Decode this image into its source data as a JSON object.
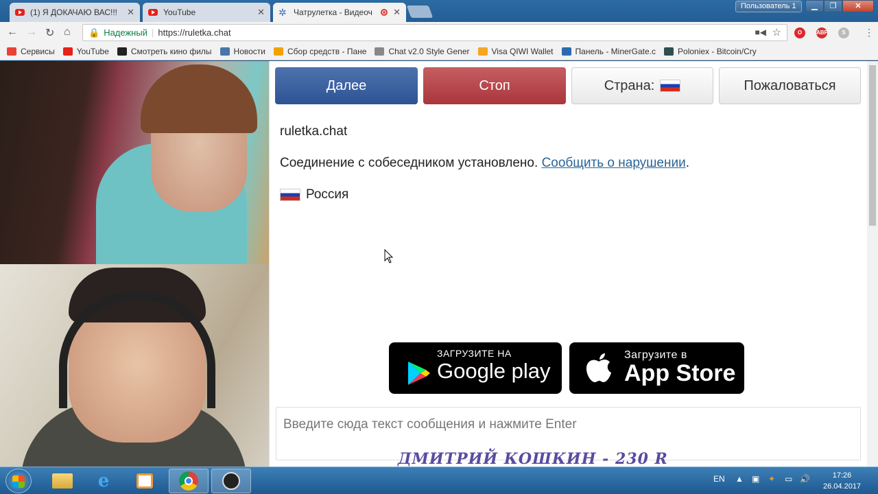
{
  "tabs": [
    {
      "title": "(1) Я ДОКАЧАЮ ВАС!!!",
      "icon": "youtube-icon"
    },
    {
      "title": "YouTube",
      "icon": "youtube-icon"
    },
    {
      "title": "Чатрулетка - Видеоч",
      "icon": "gear-icon"
    }
  ],
  "window": {
    "user_label": "Пользователь 1"
  },
  "toolbar": {
    "secure_label": "Надежный",
    "url": "https://ruletka.chat"
  },
  "bookmarks": [
    {
      "label": "Сервисы",
      "icon": "apps-icon",
      "color": "#e94235"
    },
    {
      "label": "YouTube",
      "icon": "youtube-icon",
      "color": "#e62117"
    },
    {
      "label": "Смотреть кино филы",
      "icon": "face-icon",
      "color": "#222222"
    },
    {
      "label": "Новости",
      "icon": "vk-icon",
      "color": "#4a76a8"
    },
    {
      "label": "Сбор средств - Пане",
      "icon": "donate-icon",
      "color": "#f2a200"
    },
    {
      "label": "Chat v2.0 Style Gener",
      "icon": "page-icon",
      "color": "#888888"
    },
    {
      "label": "Visa QIWI Wallet",
      "icon": "qiwi-icon",
      "color": "#f5a623"
    },
    {
      "label": "Панель - MinerGate.c",
      "icon": "minergate-icon",
      "color": "#2b6cb0"
    },
    {
      "label": "Poloniex - Bitcoin/Cry",
      "icon": "poloniex-icon",
      "color": "#2f4f4f"
    }
  ],
  "controls": {
    "next": "Далее",
    "stop": "Стоп",
    "country": "Страна:",
    "report": "Пожаловаться"
  },
  "chat": {
    "site": "ruletka.chat",
    "connected": "Соединение с собеседником установлено.",
    "report_link": "Сообщить о нарушении",
    "period": ".",
    "country": "Россия"
  },
  "stores": {
    "google_small": "ЗАГРУЗИТЕ НА",
    "google_big": "Google play",
    "apple_small": "Загрузите в",
    "apple_big": "App Store"
  },
  "input": {
    "placeholder": "Введите сюда текст сообщения и нажмите Enter"
  },
  "overlay": {
    "watermark": "ДМИТРИЙ КОШКИН - 230 R"
  },
  "taskbar": {
    "lang": "EN",
    "time": "17:26",
    "date": "26.04.2017"
  },
  "colors": {
    "next": "#3b63a3",
    "stop": "#b8474c",
    "link": "#2a6496"
  }
}
